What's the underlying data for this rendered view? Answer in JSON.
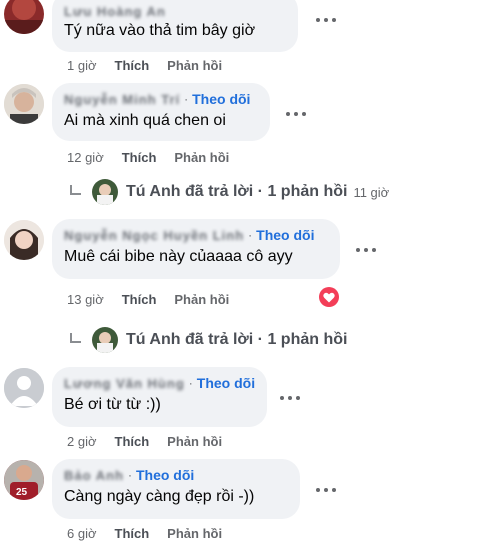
{
  "comments": [
    {
      "author_blurred": "Lưu Hoàng An",
      "text": "Tý nữa vào thả tim bây giờ",
      "time": "1 giờ",
      "like": "Thích",
      "reply": "Phản hồi"
    },
    {
      "author_blurred": "Nguyễn Minh Trí",
      "follow": "Theo dõi",
      "separator": "·",
      "text": "Ai mà xinh quá chen oi",
      "time": "12 giờ",
      "like": "Thích",
      "reply": "Phản hồi"
    },
    {
      "author_blurred": "Nguyễn Ngọc Huyền Linh",
      "follow": "Theo dõi",
      "separator": "·",
      "text": "Muê cái bibe này củaaaa cô ayy",
      "time": "13 giờ",
      "like": "Thích",
      "reply": "Phản hồi"
    },
    {
      "author_blurred": "Lương Văn Hùng",
      "follow": "Theo dõi",
      "separator": "·",
      "text": "Bé ơi từ từ :))",
      "time": "2 giờ",
      "like": "Thích",
      "reply": "Phản hồi"
    },
    {
      "author_blurred": "Bảo Anh",
      "follow": "Theo dõi",
      "separator": "·",
      "text": "Càng ngày càng đẹp rồi -))",
      "time": "6 giờ",
      "like": "Thích",
      "reply": "Phản hồi"
    }
  ],
  "reply_threads": [
    {
      "text": "Tú Anh đã trả lời · 1 phản hồi",
      "time": "11 giờ"
    },
    {
      "text": "Tú Anh đã trả lời · 1 phản hồi"
    }
  ],
  "colors": {
    "bubble": "#f0f2f5",
    "follow": "#216fdb",
    "meta": "#65676b",
    "heart": "#f33e58"
  },
  "icons": {
    "more": "more-options-icon",
    "reply_arrow": "reply-arrow-icon",
    "reaction": "love-reaction-icon"
  }
}
